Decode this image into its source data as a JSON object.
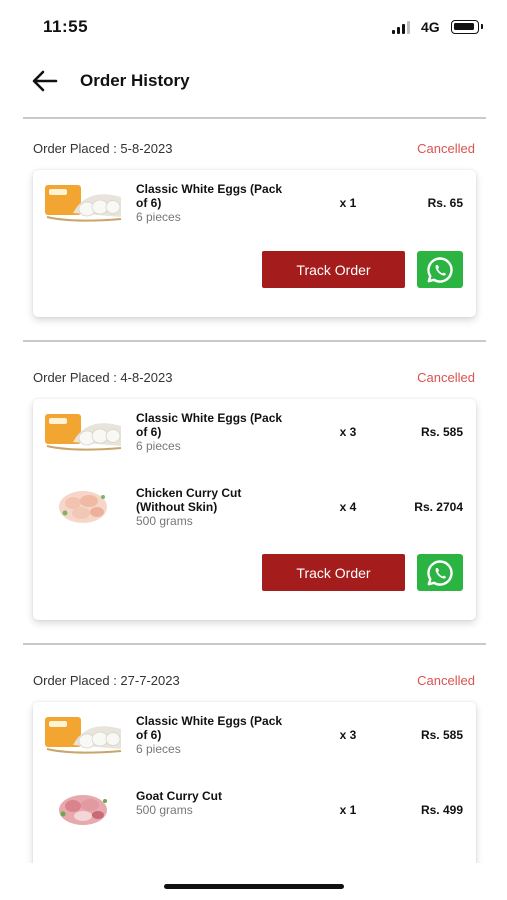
{
  "status_bar": {
    "time": "11:55",
    "network": "4G"
  },
  "header": {
    "title": "Order History",
    "back_icon": "arrow-left-icon"
  },
  "orders": [
    {
      "placed": "Order Placed : 5-8-2023",
      "status": "Cancelled",
      "items": [
        {
          "name": "Classic White Eggs (Pack of 6)",
          "sub": "6 pieces",
          "qty": "x 1",
          "price": "Rs. 65",
          "thumb": "eggs"
        }
      ],
      "track_label": "Track Order"
    },
    {
      "placed": "Order Placed : 4-8-2023",
      "status": "Cancelled",
      "items": [
        {
          "name": "Classic White Eggs (Pack of 6)",
          "sub": "6 pieces",
          "qty": "x 3",
          "price": "Rs. 585",
          "thumb": "eggs"
        },
        {
          "name": "Chicken Curry Cut (Without Skin)",
          "sub": "500 grams",
          "qty": "x 4",
          "price": "Rs. 2704",
          "thumb": "chicken"
        }
      ],
      "track_label": "Track Order"
    },
    {
      "placed": "Order Placed : 27-7-2023",
      "status": "Cancelled",
      "items": [
        {
          "name": "Classic White Eggs (Pack of 6)",
          "sub": "6 pieces",
          "qty": "x 3",
          "price": "Rs. 585",
          "thumb": "eggs"
        },
        {
          "name": "Goat Curry Cut",
          "sub": "500 grams",
          "qty": "x 1",
          "price": "Rs. 499",
          "thumb": "goat"
        }
      ]
    }
  ],
  "colors": {
    "accent": "#a51c1c",
    "status_cancelled": "#d9534f",
    "whatsapp": "#2bb441"
  }
}
